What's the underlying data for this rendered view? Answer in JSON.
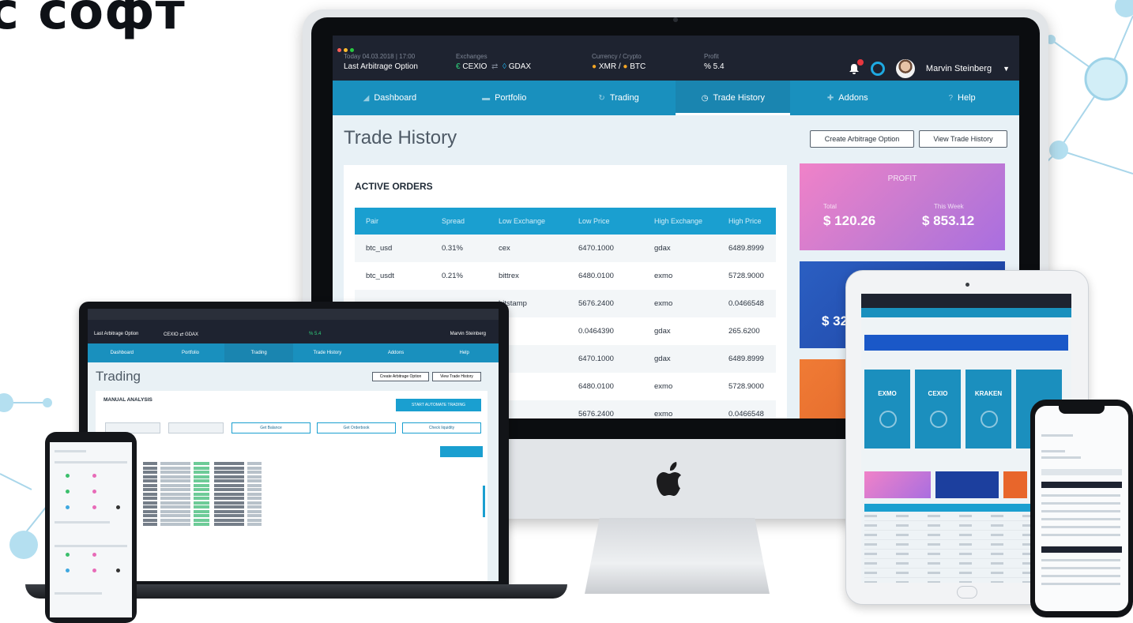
{
  "headline": "с софт",
  "imac": {
    "topbar": {
      "date_label": "Today 04.03.2018 | 17:00",
      "option_label": "Last Arbitrage Option",
      "exchanges_label": "Exchanges",
      "exchange_a": "CEXIO",
      "exchange_b": "GDAX",
      "currency_label": "Currency / Crypto",
      "currency_a": "XMR",
      "currency_b": "BTC",
      "profit_label": "Profit",
      "profit_value": "% 5.4",
      "user_name": "Marvin Steinberg"
    },
    "nav": [
      "Dashboard",
      "Portfolio",
      "Trading",
      "Trade History",
      "Addons",
      "Help"
    ],
    "active_nav_index": 3,
    "page_title": "Trade History",
    "buttons": {
      "create": "Create Arbitrage Option",
      "view": "View Trade History"
    },
    "orders": {
      "title": "ACTIVE ORDERS",
      "columns": [
        "Pair",
        "Spread",
        "Low Exchange",
        "Low Price",
        "High Exchange",
        "High Price"
      ],
      "rows": [
        [
          "btc_usd",
          "0.31%",
          "cex",
          "6470.1000",
          "gdax",
          "6489.8999"
        ],
        [
          "btc_usdt",
          "0.21%",
          "bittrex",
          "6480.0100",
          "exmo",
          "5728.9000"
        ],
        [
          "",
          "",
          "bitstamp",
          "5676.2400",
          "exmo",
          "0.0466548"
        ],
        [
          "",
          "",
          "",
          "0.0464390",
          "gdax",
          "265.6200"
        ],
        [
          "",
          "",
          "",
          "6470.1000",
          "gdax",
          "6489.8999"
        ],
        [
          "",
          "",
          "",
          "6480.0100",
          "exmo",
          "5728.9000"
        ],
        [
          "",
          "",
          "",
          "5676.2400",
          "exmo",
          "0.0466548"
        ]
      ]
    },
    "profit": {
      "title": "PROFIT",
      "total_label": "Total",
      "total_value": "$ 120.26",
      "week_label": "This Week",
      "week_value": "$ 853.12"
    },
    "blue_card_value": "$ 32"
  },
  "laptop": {
    "topbar_option": "Last Arbitrage Option",
    "exchanges": "CEXIO ⇄ GDAX",
    "profit": "% 5.4",
    "user_name": "Marvin Steinberg",
    "nav": [
      "Dashboard",
      "Portfolio",
      "Trading",
      "Trade History",
      "Addons",
      "Help"
    ],
    "active_nav_index": 2,
    "page_title": "Trading",
    "buttons": {
      "create": "Create Arbitrage Option",
      "view": "View Trade History",
      "start": "START AUTOMATE TRADING",
      "balance": "Get Balance",
      "orderbook": "Get Orderbook",
      "liquidity": "Check liquidity"
    },
    "card_title": "MANUAL ANALYSIS"
  },
  "tablet": {
    "tiles": [
      "EXMO",
      "CEXIO",
      "KRAKEN",
      ""
    ]
  },
  "colors": {
    "topbar": "#1e2330",
    "nav": "#1990be",
    "accent": "#1a9fd0",
    "profit_gradient": "#f082c8",
    "blue_card": "#2b5fc2",
    "orange_card": "#f07b35",
    "positive": "#2fd07c"
  }
}
